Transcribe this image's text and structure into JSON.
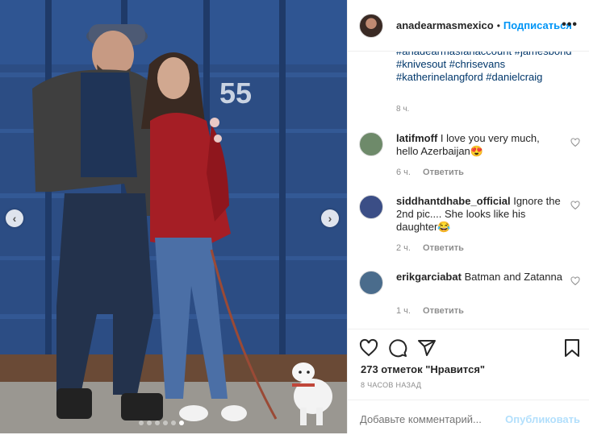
{
  "post": {
    "username": "anadearmasmexico",
    "separator": "•",
    "follow_label": "Подписаться",
    "more_label": "•••"
  },
  "caption": {
    "hashtags_line1": "#anadearmasfanaccount #jamesbond",
    "hashtags_line2": "#knivesout #chrisevans",
    "hashtags_line3": "#katherinelangford #danielcraig",
    "time": "8 ч."
  },
  "comments": [
    {
      "user": "latifmoff",
      "text": "I love you very much, hello Azerbaijan😍",
      "time": "6 ч.",
      "reply": "Ответить",
      "avatar_color": "#6e8a6a"
    },
    {
      "user": "siddhantdhabe_official",
      "text": "Ignore the 2nd pic.... She looks like his daughter😂",
      "time": "2 ч.",
      "reply": "Ответить",
      "avatar_color": "#3b4e86"
    },
    {
      "user": "erikgarciabat",
      "text": "Batman and Zatanna",
      "time": "1 ч.",
      "reply": "Ответить",
      "avatar_color": "#4a6c8c"
    }
  ],
  "likes": "273 отметок \"Нравится\"",
  "post_time": "8 ЧАСОВ НАЗАД",
  "add_comment": {
    "placeholder": "Добавьте комментарий...",
    "publish_label": "Опубликовать"
  },
  "photo": {
    "container_number": "55",
    "prev_arrow": "‹",
    "next_arrow": "›"
  },
  "colors": {
    "accent": "#0095f6",
    "publish_disabled": "#b2dffc",
    "hashtag": "#00376b",
    "muted": "#8e8e8e"
  }
}
